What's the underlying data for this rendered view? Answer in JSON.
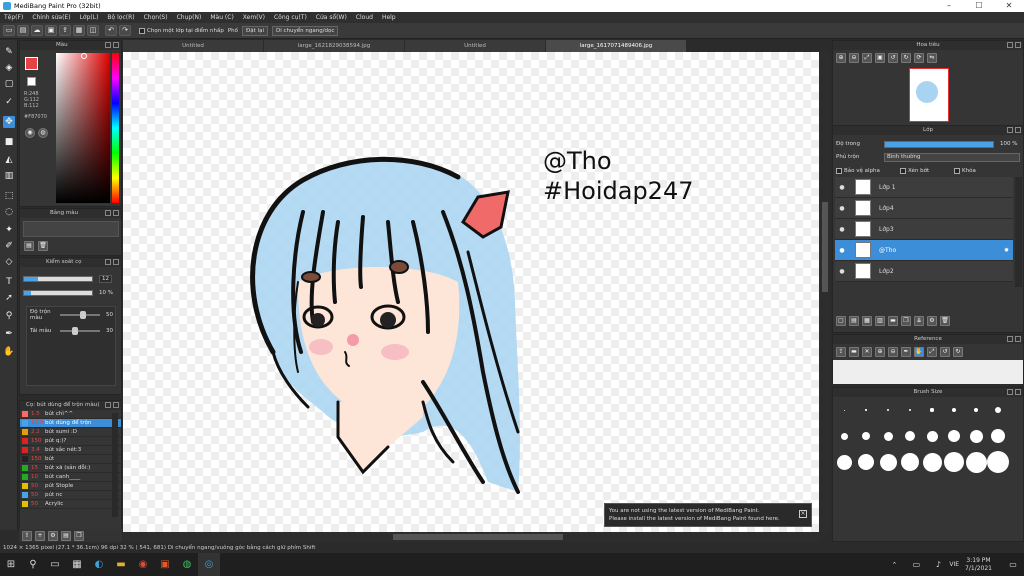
{
  "window": {
    "title": "MediBang Paint Pro (32bit)"
  },
  "menu": [
    "Tệp(F)",
    "Chỉnh sửa(E)",
    "Lớp(L)",
    "Bộ lọc(R)",
    "Chọn(S)",
    "Chụp(N)",
    "Màu (C)",
    "Xem(V)",
    "Công cụ(T)",
    "Cửa sổ(W)",
    "Cloud",
    "Help"
  ],
  "toolbar": {
    "snap_check": "Chọn một lớp tại điểm nhấp",
    "flip_label": "Phố",
    "cancel_label": "Đặt lại",
    "move_label": "Di chuyển ngang/dọc"
  },
  "tabs": [
    "Untitled",
    "large_1621829038594.jpg",
    "Untitled",
    "large_1617071489406.jpg"
  ],
  "color_panel": {
    "title": "Màu",
    "rgb": [
      "R:248",
      "G:112",
      "B:112"
    ],
    "hex": "#F87070"
  },
  "brush_panel": {
    "title": "Bảng màu"
  },
  "brush_settings": {
    "title": "Kiểm soát cọ",
    "size_value": "12",
    "opacity_value": "10 %",
    "blend_label": "Độ trộn màu",
    "blend_value": "50",
    "reuse_label": "Tái màu",
    "reuse_value": "30"
  },
  "brush_list": {
    "title": "Cọ: bút dùng để trộn màu)",
    "items": [
      {
        "size": "1.5",
        "label": "bút chì^^",
        "color": "#ff6666"
      },
      {
        "size": "12.0",
        "label": "bút dùng để trộn",
        "color": "#4aa3e6",
        "selected": true
      },
      {
        "size": "2.2",
        "label": "bút sumi :D",
        "color": "#e0a000"
      },
      {
        "size": "150",
        "label": "pút q:)?",
        "color": "#dd2222"
      },
      {
        "size": "3.4",
        "label": "bút sắc nét:3",
        "color": "#dd2222"
      },
      {
        "size": "150",
        "label": "bút",
        "color": "#222222"
      },
      {
        "size": "15",
        "label": "bút xã (sản đỗi:)",
        "color": "#22aa22"
      },
      {
        "size": "10",
        "label": "bút canh____",
        "color": "#22aa22"
      },
      {
        "size": "50",
        "label": "pút Stople",
        "color": "#e0c000"
      },
      {
        "size": "50",
        "label": "pút nc",
        "color": "#4aa3e6"
      },
      {
        "size": "50",
        "label": "Acrylic",
        "color": "#e0c000"
      }
    ]
  },
  "canvas": {
    "line1": "@Tho",
    "line2": "#Hoidap247"
  },
  "navigator": {
    "title": "Hoa tiêu"
  },
  "layers": {
    "title": "Lớp",
    "opacity_label": "Độ trong",
    "opacity_value": "100 %",
    "blend_label": "Phủ trộn",
    "blend_value": "Bình thường",
    "protect": "Bảo vệ alpha",
    "clip": "Xén bớt",
    "lock": "Khóa",
    "items": [
      {
        "name": "Lớp 1",
        "selected": false
      },
      {
        "name": "Lớp4",
        "selected": false
      },
      {
        "name": "Lớp3",
        "selected": false
      },
      {
        "name": "@Tho",
        "selected": true
      },
      {
        "name": "Lớp2",
        "selected": false
      }
    ]
  },
  "reference": {
    "title": "Reference"
  },
  "brush_size": {
    "title": "Brush Size"
  },
  "notice": {
    "line1": "You are not using the latest version of MediBang Paint.",
    "line2": "Please install the latest version of MediBang Paint found here."
  },
  "status": {
    "text": "1024 × 1365 pixel  (27.1 * 36.1cm)  96 dpi  32 %  ( 541, 681)  Di chuyển ngang/vuông góc bằng cách giữ phím Shift"
  },
  "taskbar": {
    "time": "3:19 PM",
    "date": "7/1/2021",
    "lang": "VIE"
  },
  "colors": {
    "accent": "#3c8ed8",
    "hair": "#a8d4f2",
    "bow": "#f06a6a",
    "skin": "#fde6d8"
  }
}
